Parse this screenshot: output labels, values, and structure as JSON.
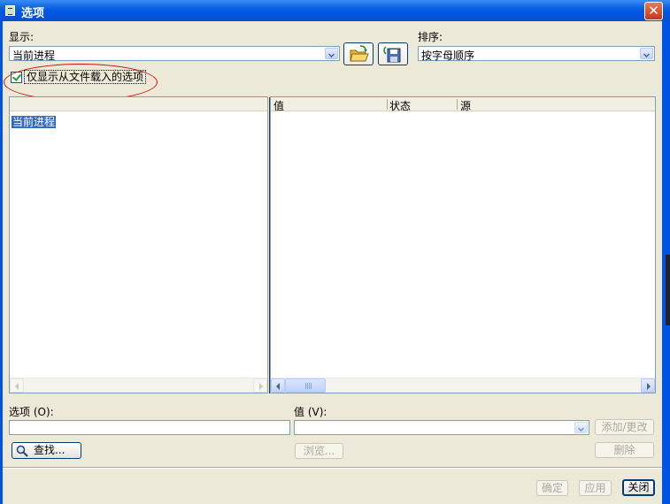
{
  "window": {
    "title": "选项",
    "close_label": "✕"
  },
  "display": {
    "label": "显示:",
    "value": "当前进程"
  },
  "sort": {
    "label": "排序:",
    "value": "按字母顺序"
  },
  "filter_checkbox": {
    "label": "仅显示从文件载入的选项",
    "checked": true
  },
  "tree": {
    "items": [
      "当前进程"
    ]
  },
  "list": {
    "columns": [
      "值",
      "状态",
      "源"
    ]
  },
  "option_field": {
    "label": "选项 (O):",
    "value": ""
  },
  "value_field": {
    "label": "值 (V):",
    "value": ""
  },
  "buttons": {
    "find": "查找...",
    "browse": "浏览...",
    "add_change": "添加/更改",
    "delete": "删除",
    "ok": "确定",
    "apply": "应用",
    "close": "关闭"
  },
  "icons": [
    "open-folder-icon",
    "save-icon",
    "search-icon"
  ]
}
